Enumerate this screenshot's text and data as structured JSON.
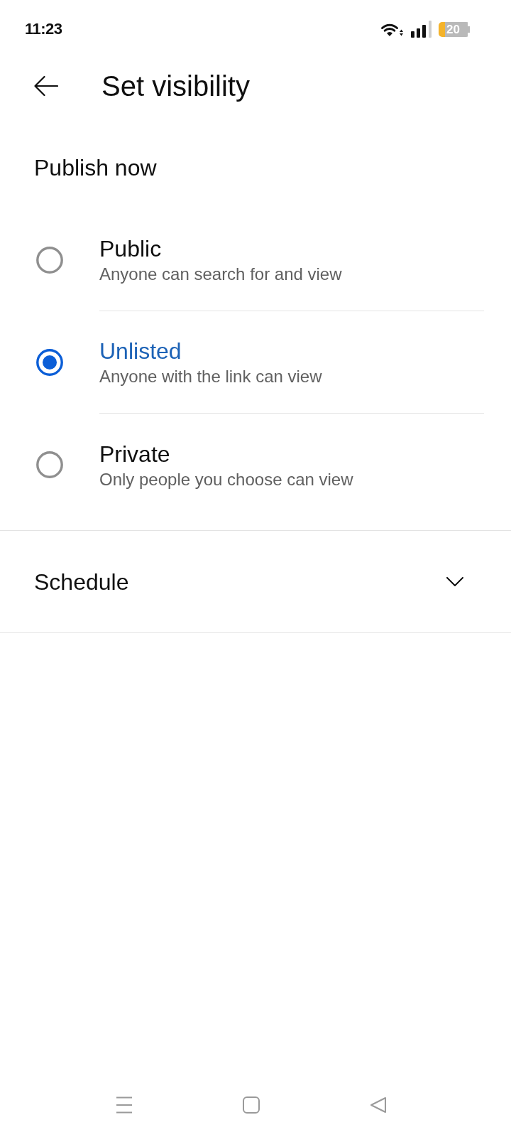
{
  "status_bar": {
    "time": "11:23",
    "battery": "20"
  },
  "header": {
    "title": "Set visibility"
  },
  "publish_now": {
    "heading": "Publish now",
    "options": [
      {
        "title": "Public",
        "description": "Anyone can search for and view",
        "selected": false
      },
      {
        "title": "Unlisted",
        "description": "Anyone with the link can view",
        "selected": true
      },
      {
        "title": "Private",
        "description": "Only people you choose can view",
        "selected": false
      }
    ]
  },
  "schedule": {
    "label": "Schedule",
    "expanded": false
  }
}
